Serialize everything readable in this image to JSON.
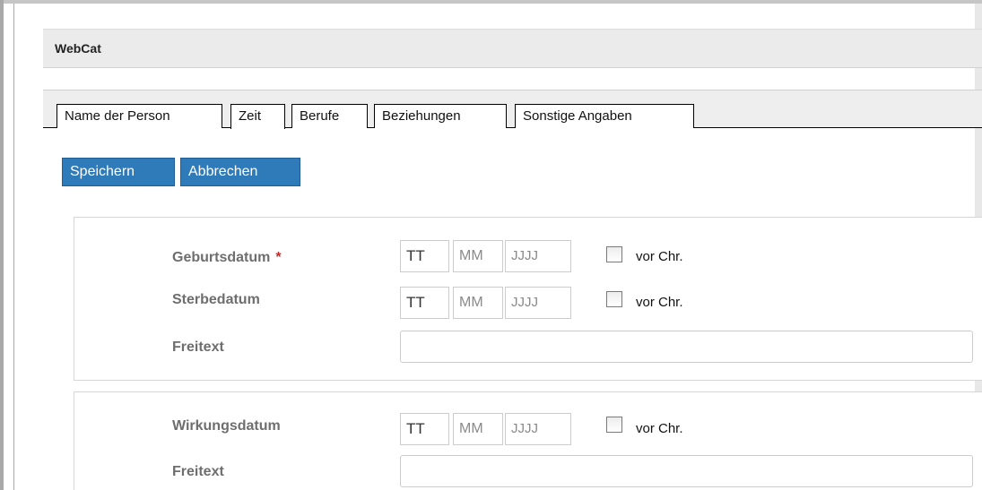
{
  "app": {
    "title": "WebCat"
  },
  "tabs": [
    {
      "label": "Name der Person",
      "active": false
    },
    {
      "label": "Zeit",
      "active": true
    },
    {
      "label": "Berufe",
      "active": false
    },
    {
      "label": "Beziehungen",
      "active": false
    },
    {
      "label": "Sonstige Angaben",
      "active": false
    }
  ],
  "buttons": {
    "save": "Speichern",
    "cancel": "Abbrechen"
  },
  "colors": {
    "button_bg": "#2f7ab8",
    "required_marker": "#e02020",
    "title_bg": "#ebebeb"
  },
  "form": {
    "birth": {
      "label": "Geburtsdatum",
      "required_marker": "*",
      "day_placeholder": "TT",
      "month_placeholder": "MM",
      "year_placeholder": "JJJJ",
      "bc_label": "vor Chr.",
      "bc_checked": false
    },
    "death": {
      "label": "Sterbedatum",
      "day_placeholder": "TT",
      "month_placeholder": "MM",
      "year_placeholder": "JJJJ",
      "bc_label": "vor Chr.",
      "bc_checked": false
    },
    "freetext1": {
      "label": "Freitext",
      "value": ""
    },
    "activity": {
      "label": "Wirkungsdatum",
      "day_placeholder": "TT",
      "month_placeholder": "MM",
      "year_placeholder": "JJJJ",
      "bc_label": "vor Chr.",
      "bc_checked": false
    },
    "freetext2": {
      "label": "Freitext",
      "value": ""
    }
  }
}
